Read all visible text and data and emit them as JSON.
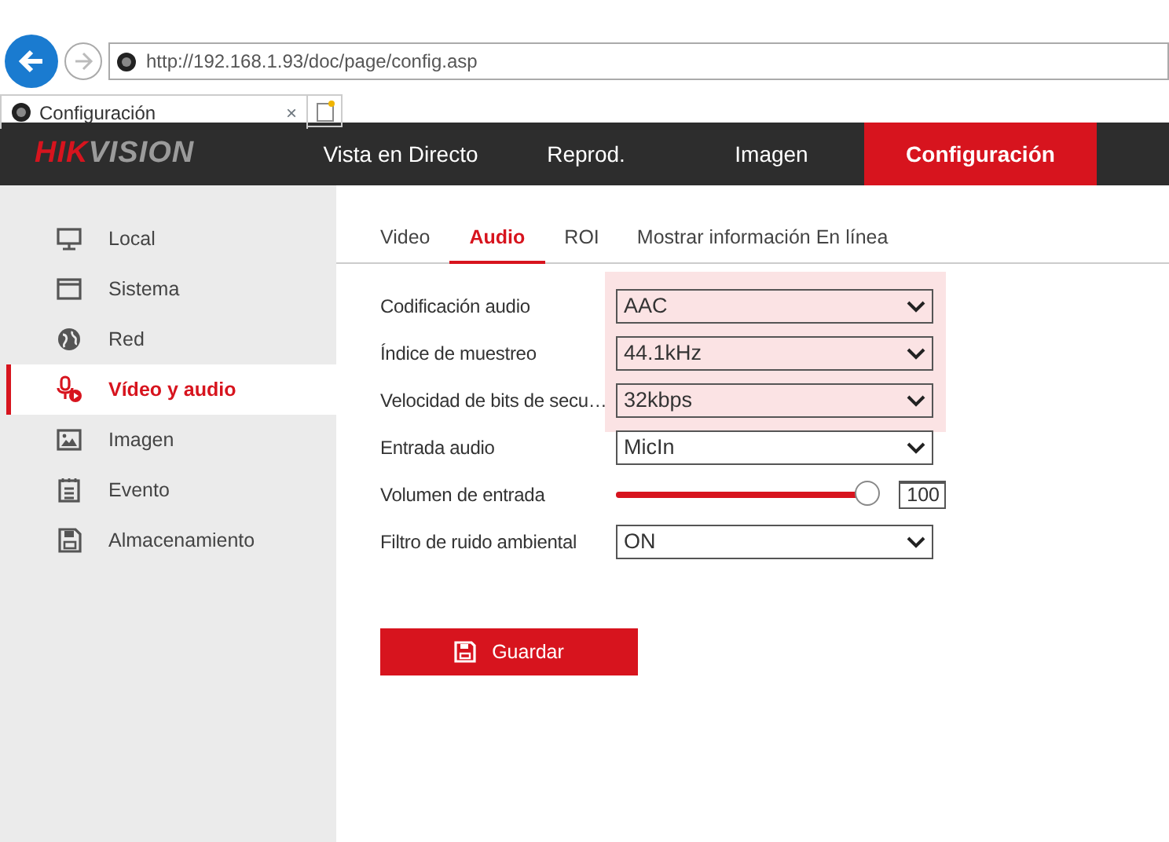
{
  "browser": {
    "address": "http://192.168.1.93/doc/page/config.asp",
    "tab_title": "Configuración",
    "tab_close": "×"
  },
  "logo": [
    {
      "text": "HIK",
      "color": "#d7141e"
    },
    {
      "text": "VISION",
      "color": "#9b9b9b"
    }
  ],
  "top_nav": [
    {
      "label": "Vista en Directo",
      "selected": false
    },
    {
      "label": "Reprod.",
      "selected": false
    },
    {
      "label": "Imagen",
      "selected": false
    },
    {
      "label": "Configuración",
      "selected": true
    }
  ],
  "sidebar": {
    "items": [
      {
        "label": "Local",
        "selected": false
      },
      {
        "label": "Sistema",
        "selected": false
      },
      {
        "label": "Red",
        "selected": false
      },
      {
        "label": "Vídeo y audio",
        "selected": true
      },
      {
        "label": "Imagen",
        "selected": false
      },
      {
        "label": "Evento",
        "selected": false
      },
      {
        "label": "Almacenamiento",
        "selected": false
      }
    ]
  },
  "tabs": [
    {
      "label": "Video",
      "selected": false
    },
    {
      "label": "Audio",
      "selected": true
    },
    {
      "label": "ROI",
      "selected": false
    },
    {
      "label": "Mostrar información En línea",
      "selected": false
    }
  ],
  "fields": [
    {
      "kind": "select",
      "label": "Codificación audio",
      "value": "AAC",
      "highlighted": true
    },
    {
      "kind": "select",
      "label": "Índice de muestreo",
      "value": "44.1kHz",
      "highlighted": true
    },
    {
      "kind": "select",
      "label": "Velocidad de bits de secu…",
      "value": "32kbps",
      "highlighted": true
    },
    {
      "kind": "select",
      "label": "Entrada audio",
      "value": "MicIn",
      "highlighted": false
    },
    {
      "kind": "slider",
      "label": "Volumen de entrada",
      "level": 1.0,
      "value": "100",
      "highlighted": false
    },
    {
      "kind": "select",
      "label": "Filtro de ruido ambiental",
      "value": "ON",
      "highlighted": false
    }
  ],
  "save_button": "Guardar"
}
